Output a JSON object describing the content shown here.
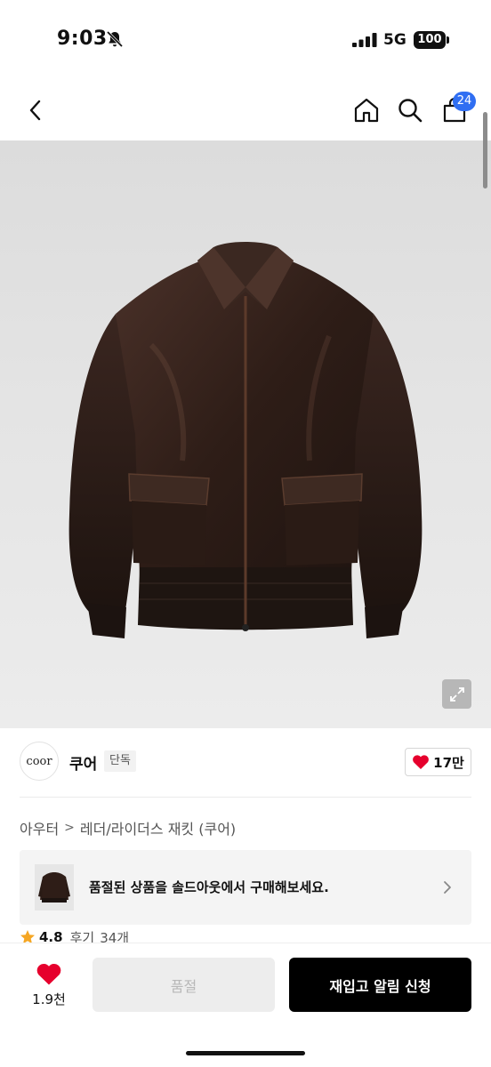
{
  "status_bar": {
    "time": "9:03",
    "network": "5G",
    "battery": "100",
    "icons": [
      "bell-slash-icon",
      "signal-icon",
      "battery-icon"
    ]
  },
  "nav": {
    "icons": [
      "back-chevron-icon",
      "home-icon",
      "search-icon",
      "cart-icon"
    ],
    "cart_count": "24"
  },
  "product_image": {
    "icon": "expand-icon"
  },
  "brand": {
    "logo_text": "coor",
    "name": "쿠어",
    "badge": "단독",
    "like_count": "17만"
  },
  "breadcrumb": {
    "items": [
      "아우터",
      "레더/라이더스 재킷 (쿠어)"
    ],
    "separator": ">"
  },
  "soldout_banner": {
    "text": "품절된 상품을 솔드아웃에서 구매해보세요."
  },
  "rating": {
    "value": "4.8",
    "review_label": "후기",
    "review_count": "34개"
  },
  "bottom_bar": {
    "wish_count": "1.9천",
    "soldout_label": "품절",
    "restock_label": "재입고 알림 신청"
  },
  "colors": {
    "accent_red": "#e6002d",
    "badge_blue": "#2f6ef2",
    "cta_black": "#000000"
  }
}
